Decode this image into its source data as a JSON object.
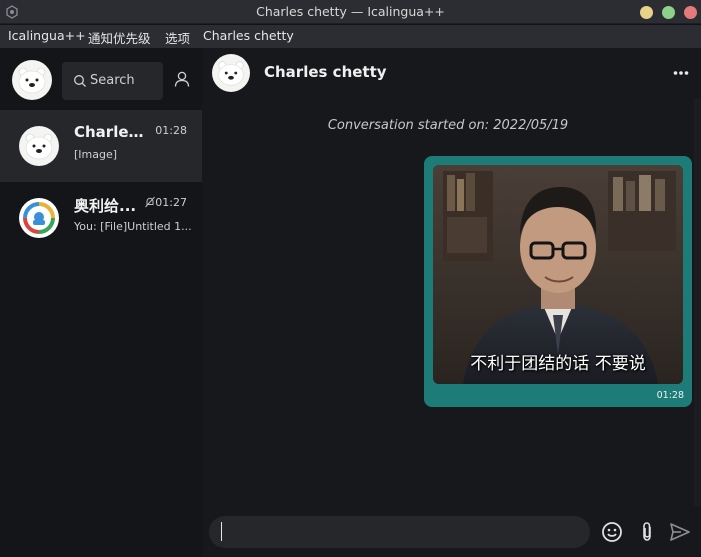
{
  "window": {
    "title": "Charles chetty — Icalingua++"
  },
  "menubar": {
    "items": [
      "Icalingua++",
      "通知优先级",
      "选项",
      "Charles chetty"
    ]
  },
  "sidebar": {
    "search": {
      "placeholder": "Search"
    },
    "chats": [
      {
        "name": "Charles ...",
        "time": "01:28",
        "preview": "[Image]",
        "avatar": "polar-bear-avatar",
        "active": true
      },
      {
        "name": "奥利给...",
        "time": "01:27",
        "preview": "You: [File]Untitled 1...",
        "avatar": "group-avatar",
        "muted": true
      }
    ]
  },
  "main": {
    "chat_title": "Charles chetty",
    "conversation_start": "Conversation started on: 2022/05/19",
    "messages": [
      {
        "type": "image",
        "caption": "不利于团结的话 不要说",
        "time": "01:28",
        "outgoing": true
      }
    ],
    "composer": {
      "value": ""
    }
  },
  "colors": {
    "accent": "#1d7c78",
    "background": "#121316",
    "panel": "#17181b",
    "input": "#26272b"
  },
  "icons": [
    "app-icon",
    "search-icon",
    "contacts-icon",
    "mute-icon",
    "more-icon",
    "emoji-icon",
    "attach-icon",
    "send-icon"
  ]
}
